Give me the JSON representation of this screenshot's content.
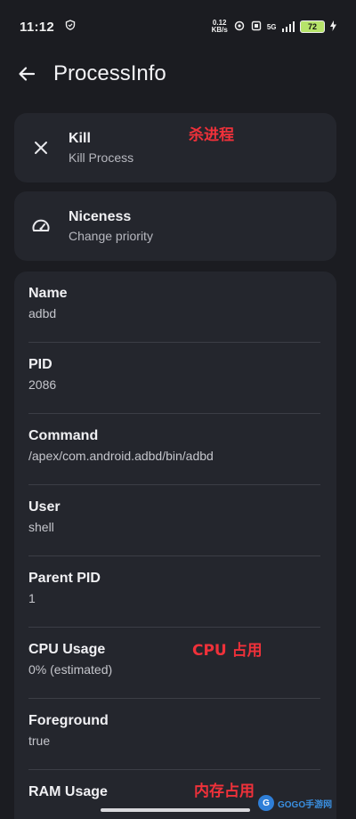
{
  "status_bar": {
    "time": "11:12",
    "net_speed_value": "0.12",
    "net_speed_unit": "KB/s",
    "network_type": "5G",
    "battery": "72"
  },
  "app_bar": {
    "title": "ProcessInfo",
    "back_icon": "arrow-left-icon"
  },
  "actions": [
    {
      "title": "Kill",
      "subtitle": "Kill Process",
      "icon": "close-icon"
    },
    {
      "title": "Niceness",
      "subtitle": "Change priority",
      "icon": "speedometer-icon"
    }
  ],
  "info": [
    {
      "label": "Name",
      "value": "adbd"
    },
    {
      "label": "PID",
      "value": "2086"
    },
    {
      "label": "Command",
      "value": "/apex/com.android.adbd/bin/adbd"
    },
    {
      "label": "User",
      "value": "shell"
    },
    {
      "label": "Parent PID",
      "value": "1"
    },
    {
      "label": "CPU Usage",
      "value": "0% (estimated)"
    },
    {
      "label": "Foreground",
      "value": "true"
    },
    {
      "label": "RAM Usage",
      "value": ""
    }
  ],
  "annotations": {
    "kill": "杀进程",
    "cpu": "CPU 占用",
    "ram": "内存占用"
  },
  "watermark": {
    "text": "GOGO手游网"
  },
  "colors": {
    "background": "#1b1c21",
    "card": "#24262d",
    "annotation": "#f0313a"
  }
}
